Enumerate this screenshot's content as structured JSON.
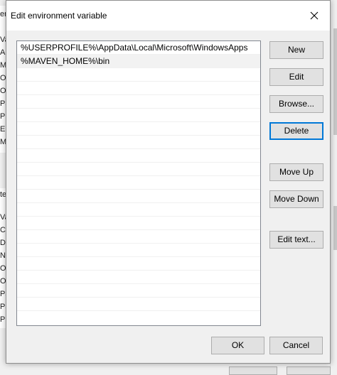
{
  "background": {
    "left_chars": [
      "er",
      "Va",
      "A",
      "M",
      "Or",
      "Or",
      "Pa",
      "P",
      "E",
      "M",
      "te",
      "Va",
      "Co",
      "Dr",
      "NU",
      "Or",
      "OS",
      "Pa",
      "Pa",
      "P"
    ]
  },
  "dialog": {
    "title": "Edit environment variable",
    "close_label": "×",
    "entries": [
      "%USERPROFILE%\\AppData\\Local\\Microsoft\\WindowsApps",
      "%MAVEN_HOME%\\bin"
    ],
    "empty_row_count": 18,
    "buttons": {
      "new": "New",
      "edit": "Edit",
      "browse": "Browse...",
      "delete": "Delete",
      "move_up": "Move Up",
      "move_down": "Move Down",
      "edit_text": "Edit text...",
      "ok": "OK",
      "cancel": "Cancel"
    },
    "colors": {
      "focus_accent": "#0078d7",
      "dialog_bg": "#f0f0f0",
      "button_bg": "#e1e1e1"
    }
  }
}
